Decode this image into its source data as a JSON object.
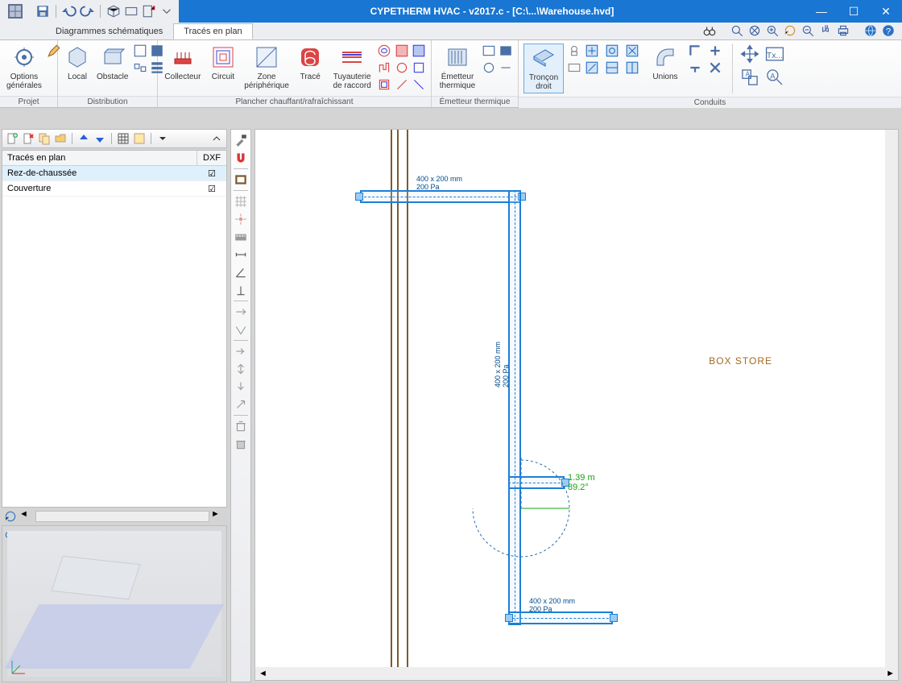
{
  "title": "CYPETHERM HVAC - v2017.c - [C:\\...\\Warehouse.hvd]",
  "tabs": [
    "Diagrammes schématiques",
    "Tracés en plan"
  ],
  "active_tab": 1,
  "ribbon": {
    "groups": [
      {
        "label": "Projet",
        "buttons": [
          {
            "label": "Options\ngénérales",
            "name": "options-generales"
          }
        ]
      },
      {
        "label": "Distribution",
        "buttons": [
          {
            "label": "Local",
            "name": "local"
          },
          {
            "label": "Obstacle",
            "name": "obstacle"
          }
        ]
      },
      {
        "label": "Plancher chauffant/rafraîchissant",
        "buttons": [
          {
            "label": "Collecteur",
            "name": "collecteur"
          },
          {
            "label": "Circuit",
            "name": "circuit"
          },
          {
            "label": "Zone\npériphérique",
            "name": "zone-peripherique"
          },
          {
            "label": "Tracé",
            "name": "trace"
          },
          {
            "label": "Tuyauterie\nde raccord",
            "name": "tuyauterie-raccord"
          }
        ]
      },
      {
        "label": "Émetteur thermique",
        "buttons": [
          {
            "label": "Émetteur\nthermique",
            "name": "emetteur-thermique"
          }
        ]
      },
      {
        "label": "Conduits",
        "buttons": [
          {
            "label": "Tronçon\ndroit",
            "name": "troncon-droit",
            "selected": true
          },
          {
            "label": "Unions",
            "name": "unions"
          }
        ]
      }
    ]
  },
  "panel": {
    "header": {
      "c1": "Tracés en plan",
      "c2": "DXF"
    },
    "rows": [
      {
        "label": "Rez-de-chaussée",
        "checked": true,
        "selected": true
      },
      {
        "label": "Couverture",
        "checked": true,
        "selected": false
      }
    ]
  },
  "drawing": {
    "room_label": "BOX STORE",
    "dim_top": "400 x 200 mm\n200 Pa",
    "dim_mid": "400 x 200 mm\n200 Pa",
    "dim_bottom": "400 x 200 mm\n200 Pa",
    "measure": {
      "len": "1.39 m",
      "ang": "89.2°"
    }
  }
}
